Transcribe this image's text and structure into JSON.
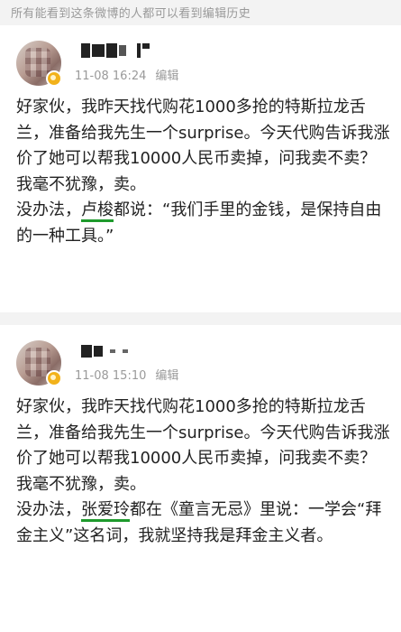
{
  "notice": "所有能看到这条微博的人都可以看到编辑历史",
  "posts": [
    {
      "time": "11-08 16:24",
      "edit_label": "编辑",
      "lines": [
        "好家伙，我昨天找代购花1000多抢的特斯拉龙舌兰，准备给我先生一个surprise。今天代购告诉我涨价了她可以帮我10000人民币卖掉，问我卖不卖？",
        "我毫不犹豫，卖。"
      ],
      "quote_pre": "没办法，",
      "quote_name": "卢梭",
      "quote_post": "都说：“我们手里的金钱，是保持自由的一种工具。”"
    },
    {
      "time": "11-08 15:10",
      "edit_label": "编辑",
      "lines": [
        "好家伙，我昨天找代购花1000多抢的特斯拉龙舌兰，准备给我先生一个surprise。今天代购告诉我涨价了她可以帮我10000人民币卖掉，问我卖不卖？",
        "我毫不犹豫，卖。"
      ],
      "quote_pre": "没办法，",
      "quote_name": "张爱玲",
      "quote_post": "都在《童言无忌》里说：一学会“拜金主义”这名词，我就坚持我是拜金主义者。"
    }
  ],
  "colors": {
    "underline": "#1e9a2c",
    "badge": "#f2b21b",
    "meta": "#9a9a9a"
  }
}
